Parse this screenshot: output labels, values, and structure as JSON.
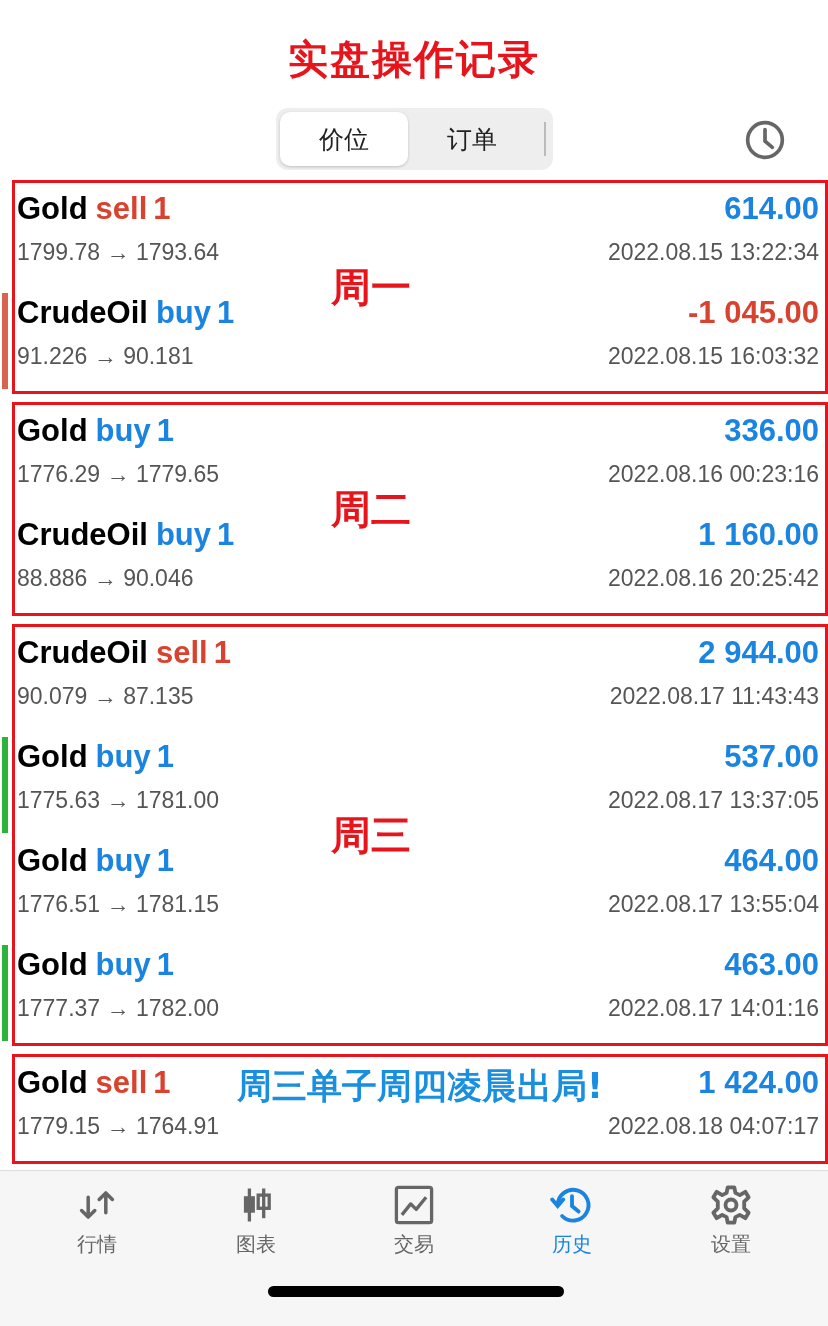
{
  "title": "实盘操作记录",
  "segments": [
    {
      "label": "价位",
      "selected": true
    },
    {
      "label": "订单",
      "selected": false
    }
  ],
  "groups": [
    {
      "note": "周一",
      "color": "#e8141c",
      "trades": [
        {
          "symbol": "Gold",
          "side": "sell",
          "volume": "1",
          "profit": "614.00",
          "negative": false,
          "prices": "1799.78 → 1793.64",
          "time": "2022.08.15 13:22:34"
        },
        {
          "symbol": "CrudeOil",
          "side": "buy",
          "volume": "1",
          "profit": "-1 045.00",
          "negative": true,
          "prices": "91.226 → 90.181",
          "time": "2022.08.15 16:03:32",
          "color": "#d9634f"
        }
      ]
    },
    {
      "note": "周二",
      "color": "#e8141c",
      "trades": [
        {
          "symbol": "Gold",
          "side": "buy",
          "volume": "1",
          "profit": "336.00",
          "negative": false,
          "prices": "1776.29 → 1779.65",
          "time": "2022.08.16 00:23:16"
        },
        {
          "symbol": "CrudeOil",
          "side": "buy",
          "volume": "1",
          "profit": "1 160.00",
          "negative": false,
          "prices": "88.886 → 90.046",
          "time": "2022.08.16 20:25:42"
        }
      ]
    },
    {
      "note": "周三",
      "color": "#e8141c",
      "trades": [
        {
          "symbol": "CrudeOil",
          "side": "sell",
          "volume": "1",
          "profit": "2 944.00",
          "negative": false,
          "prices": "90.079 → 87.135",
          "time": "2022.08.17 11:43:43"
        },
        {
          "symbol": "Gold",
          "side": "buy",
          "volume": "1",
          "profit": "537.00",
          "negative": false,
          "prices": "1775.63 → 1781.00",
          "time": "2022.08.17 13:37:05",
          "color": "#2eb33a"
        },
        {
          "symbol": "Gold",
          "side": "buy",
          "volume": "1",
          "profit": "464.00",
          "negative": false,
          "prices": "1776.51 → 1781.15",
          "time": "2022.08.17 13:55:04"
        },
        {
          "symbol": "Gold",
          "side": "buy",
          "volume": "1",
          "profit": "463.00",
          "negative": false,
          "prices": "1777.37 → 1782.00",
          "time": "2022.08.17 14:01:16",
          "color": "#2eb33a"
        }
      ]
    },
    {
      "note": "周三单子周四凌晨出局!",
      "color": "#1a8fe0",
      "trades": [
        {
          "symbol": "Gold",
          "side": "sell",
          "volume": "1",
          "profit": "1 424.00",
          "negative": false,
          "prices": "1779.15 → 1764.91",
          "time": "2022.08.18 04:07:17"
        }
      ]
    }
  ],
  "tabs": [
    {
      "label": "行情",
      "kind": "quotes",
      "selected": false
    },
    {
      "label": "图表",
      "kind": "chart",
      "selected": false
    },
    {
      "label": "交易",
      "kind": "trade",
      "selected": false
    },
    {
      "label": "历史",
      "kind": "history",
      "selected": true
    },
    {
      "label": "设置",
      "kind": "settings",
      "selected": false
    }
  ]
}
